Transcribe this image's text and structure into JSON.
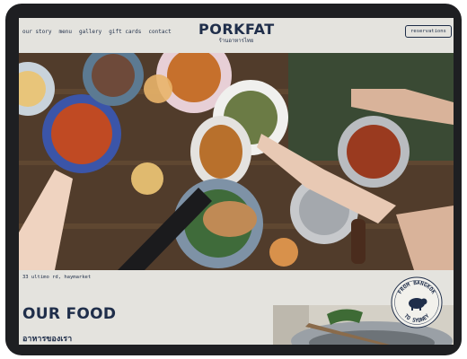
{
  "nav": {
    "items": [
      "our story",
      "menu",
      "gallery",
      "gift cards",
      "contact"
    ]
  },
  "logo": {
    "name": "PORKFAT",
    "thai": "ร้านอาหารไทย"
  },
  "header": {
    "reservations_label": "reservations"
  },
  "info": {
    "address": "33 ultimo rd, haymarket"
  },
  "section": {
    "title": "OUR FOOD",
    "thai_title": "อาหารของเรา"
  },
  "badge": {
    "text_top": "FROM BANGKOK",
    "text_bottom": "TO SYDNEY"
  },
  "colors": {
    "background": "#e4e3de",
    "navy": "#1f2e4a",
    "bezel": "#1e1f22"
  }
}
